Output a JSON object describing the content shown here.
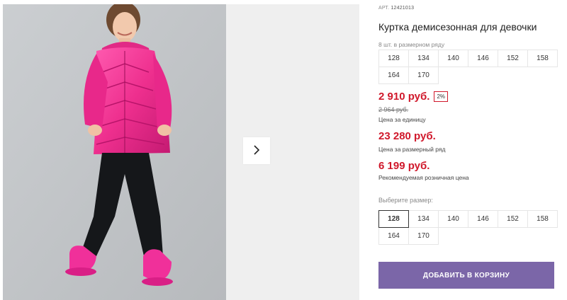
{
  "gallery": {
    "next_icon": "chevron-right-icon"
  },
  "product": {
    "art_label": "АРТ.",
    "art_number": "12421013",
    "title": "Куртка демисезонная для девочки",
    "pack_note": "8 шт. в размерном ряду",
    "pack_sizes": [
      "128",
      "134",
      "140",
      "146",
      "152",
      "158",
      "164",
      "170"
    ],
    "price": "2 910 руб.",
    "discount": "2%",
    "old_price": "2 964 руб.",
    "price_caption": "Цена за единицу",
    "row_price": "23 280 руб.",
    "row_price_caption": "Цена за размерный ряд",
    "retail_price": "6 199 руб.",
    "retail_price_caption": "Рекомендуемая розничная цена",
    "choose_size_label": "Выберите размер:",
    "select_sizes": [
      "128",
      "134",
      "140",
      "146",
      "152",
      "158",
      "164",
      "170"
    ],
    "selected_size": "128",
    "add_to_cart_label": "ДОБАВИТЬ В КОРЗИНУ"
  },
  "colors": {
    "accent_price": "#d0182b",
    "cart_button": "#7b66a8",
    "jacket": "#ee2f8e"
  }
}
